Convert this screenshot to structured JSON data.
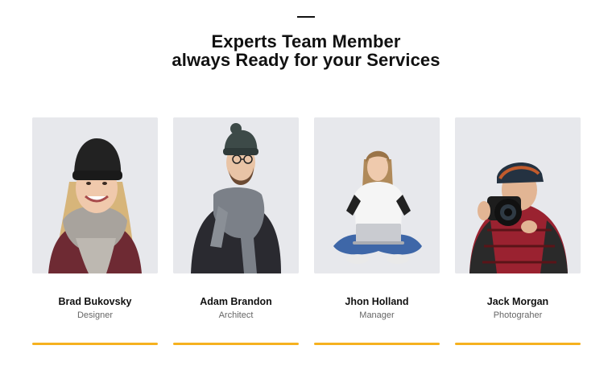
{
  "section": {
    "title_line1": "Experts Team Member",
    "title_line2": "always Ready for your Services",
    "accent_color": "#f6b11f"
  },
  "team": [
    {
      "name": "Brad Bukovsky",
      "role": "Designer",
      "photo_icon": "woman-beanie-scarf-portrait"
    },
    {
      "name": "Adam Brandon",
      "role": "Architect",
      "photo_icon": "man-beanie-scarf-portrait"
    },
    {
      "name": "Jhon Holland",
      "role": "Manager",
      "photo_icon": "woman-laptop-portrait"
    },
    {
      "name": "Jack Morgan",
      "role": "Photograher",
      "photo_icon": "photographer-camera-portrait"
    }
  ]
}
